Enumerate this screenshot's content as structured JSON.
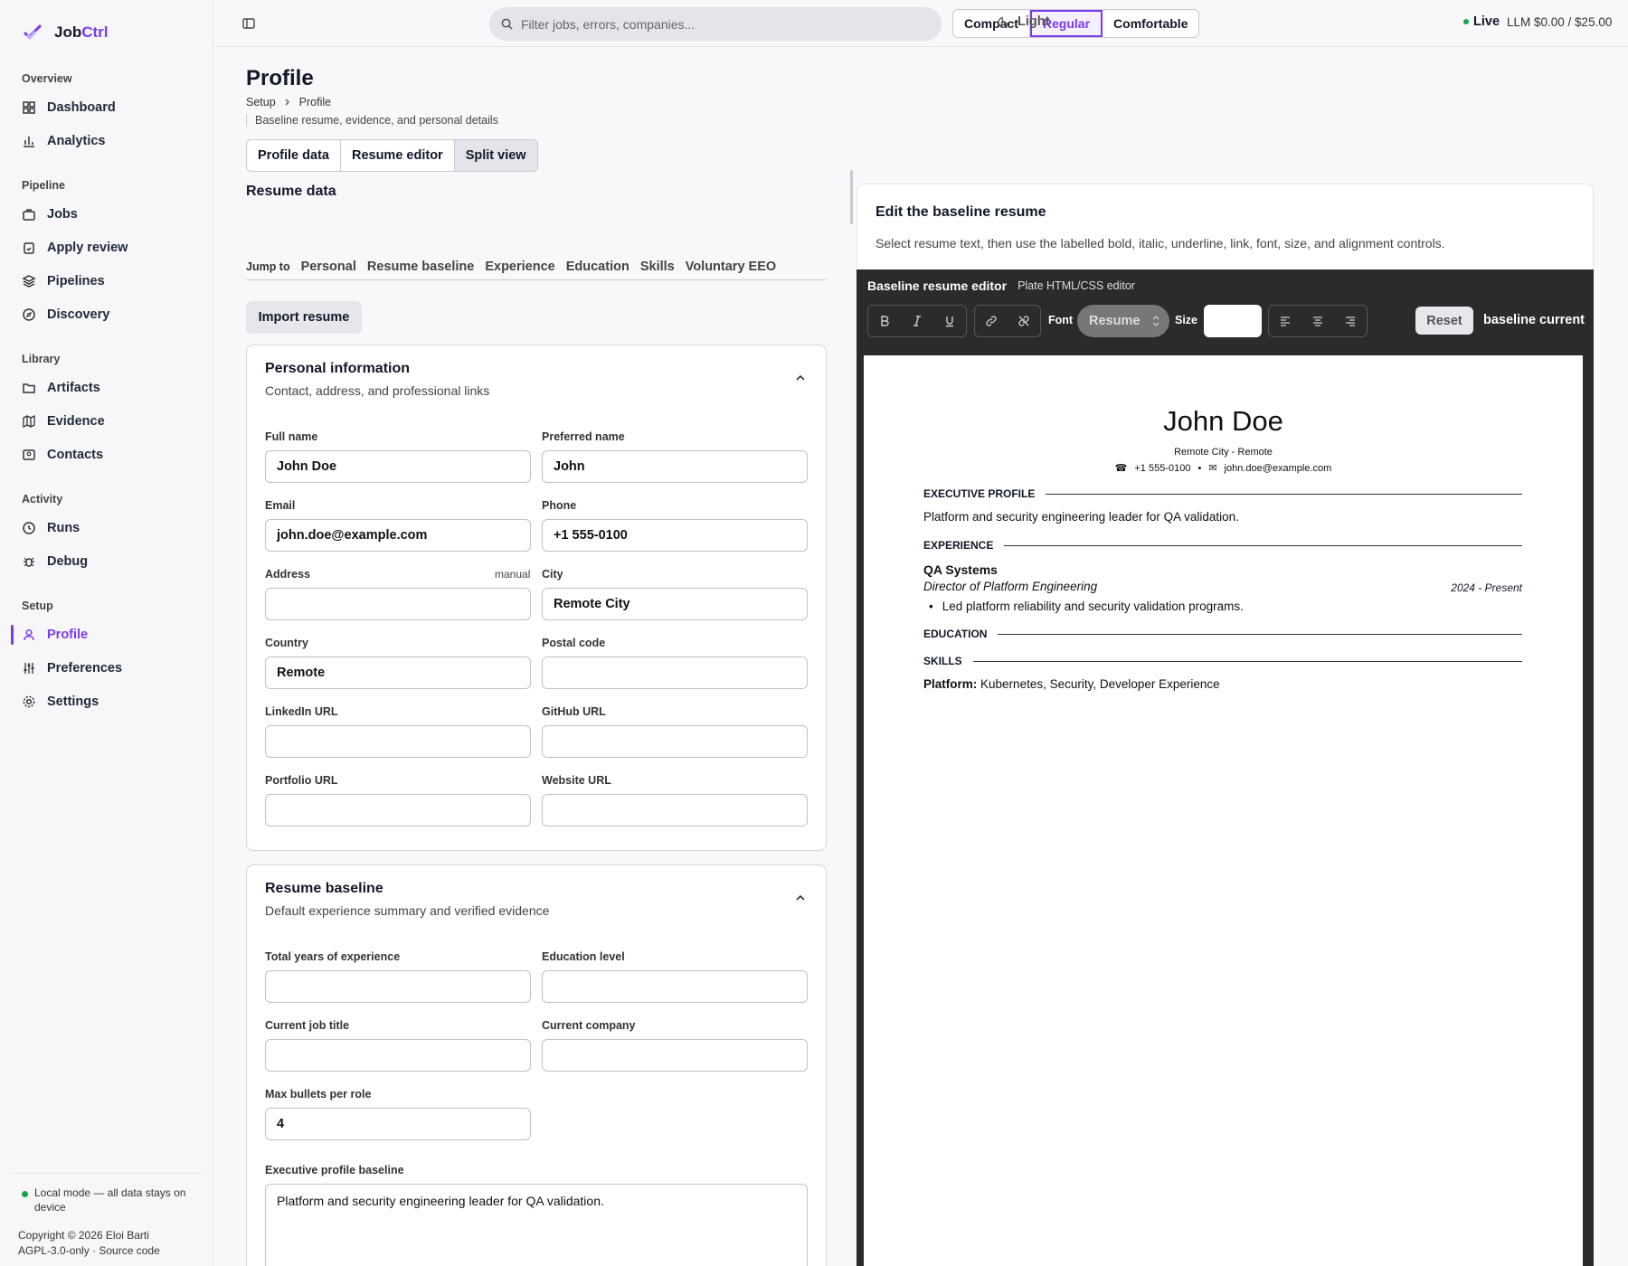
{
  "app": {
    "name_a": "Job",
    "name_b": "Ctrl"
  },
  "sidebar": {
    "sections": [
      "Overview",
      "Pipeline",
      "Library",
      "Activity",
      "Setup"
    ],
    "items": [
      "Dashboard",
      "Analytics",
      "Jobs",
      "Apply review",
      "Pipelines",
      "Discovery",
      "Artifacts",
      "Evidence",
      "Contacts",
      "Runs",
      "Debug",
      "Profile",
      "Preferences",
      "Settings"
    ],
    "footer": {
      "local": "Local mode — all data stays on device",
      "copyright": "Copyright © 2026 Eloi Barti",
      "license": "AGPL-3.0-only · Source code"
    }
  },
  "topbar": {
    "search_placeholder": "Filter jobs, errors, companies...",
    "density": [
      "Compact",
      "Regular",
      "Comfortable"
    ],
    "theme": "Light",
    "live": "Live",
    "llm": "LLM $0.00 / $25.00"
  },
  "page": {
    "title": "Profile",
    "breadcrumb": [
      "Setup",
      "Profile"
    ],
    "subtitle": "Baseline resume, evidence, and personal details",
    "view_tabs": [
      "Profile data",
      "Resume editor",
      "Split view"
    ],
    "resume_data_title": "Resume data",
    "jump_label": "Jump to",
    "jump_links": [
      "Personal",
      "Resume baseline",
      "Experience",
      "Education",
      "Skills",
      "Voluntary EEO"
    ],
    "import_button": "Import resume"
  },
  "personal": {
    "title": "Personal information",
    "subtitle": "Contact, address, and professional links",
    "full_name_label": "Full name",
    "full_name": "John Doe",
    "preferred_label": "Preferred name",
    "preferred": "John",
    "email_label": "Email",
    "email": "john.doe@example.com",
    "phone_label": "Phone",
    "phone": "+1 555-0100",
    "address_label": "Address",
    "address_tag": "manual",
    "address": "",
    "city_label": "City",
    "city": "Remote City",
    "country_label": "Country",
    "country": "Remote",
    "postal_label": "Postal code",
    "postal": "",
    "linkedin_label": "LinkedIn URL",
    "github_label": "GitHub URL",
    "portfolio_label": "Portfolio URL",
    "website_label": "Website URL"
  },
  "baseline": {
    "title": "Resume baseline",
    "subtitle": "Default experience summary and verified evidence",
    "years_label": "Total years of experience",
    "edu_label": "Education level",
    "job_label": "Current job title",
    "company_label": "Current company",
    "bullets_label": "Max bullets per role",
    "bullets": "4",
    "exec_label": "Executive profile baseline",
    "exec": "Platform and security engineering leader for QA validation."
  },
  "editor": {
    "card_title": "Edit the baseline resume",
    "card_desc": "Select resume text, then use the labelled bold, italic, underline, link, font, size, and alignment controls.",
    "title": "Baseline resume editor",
    "subtitle": "Plate HTML/CSS editor",
    "font_label": "Font",
    "font_value": "Resume",
    "size_label": "Size",
    "size_value": "",
    "reset": "Reset",
    "status": "baseline current"
  },
  "resume": {
    "name": "John Doe",
    "location": "Remote City - Remote",
    "phone": "+1 555-0100",
    "sep": "•",
    "email": "john.doe@example.com",
    "h_exec": "EXECUTIVE PROFILE",
    "exec": "Platform and security engineering leader for QA validation.",
    "h_exp": "EXPERIENCE",
    "company": "QA Systems",
    "role": "Director of Platform Engineering",
    "dates": "2024 - Present",
    "bullet": "Led platform reliability and security validation programs.",
    "h_edu": "EDUCATION",
    "h_skills": "SKILLS",
    "skills_label": "Platform:",
    "skills": "Kubernetes, Security, Developer Experience"
  },
  "colors": {
    "accent": "#7c3aed",
    "live": "#16a34a"
  }
}
